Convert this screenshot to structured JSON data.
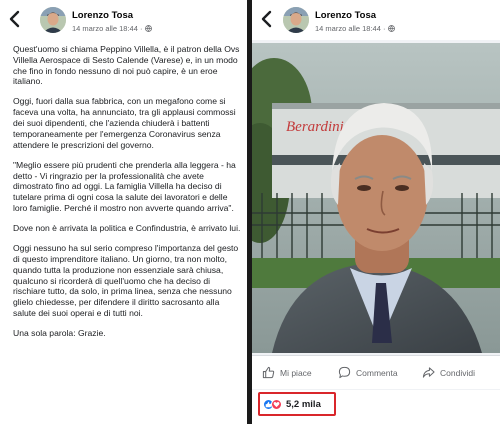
{
  "left_post": {
    "author": "Lorenzo Tosa",
    "timestamp": "14 marzo alle 18:44 · ",
    "paragraphs": [
      "Quest'uomo si chiama Peppino Villella, è il patron della Ovs Villella Aerospace di Sesto Calende (Varese) e, in un modo che fino in fondo nessuno di noi può capire, è un eroe italiano.",
      "Oggi, fuori dalla sua fabbrica, con un megafono come si faceva una volta, ha annunciato, tra gli applausi commossi dei suoi dipendenti, che l'azienda chiuderà i battenti temporaneamente per l'emergenza Coronavirus senza attendere le prescrizioni del governo.",
      "\"Meglio essere più prudenti che prenderla alla leggera - ha detto - Vi ringrazio per la professionalità che avete dimostrato fino ad oggi. La famiglia Villella ha deciso di tutelare prima di ogni cosa la salute dei lavoratori e delle loro famiglie. Perché il mostro non avverte quando arriva\".",
      "Dove non è arrivata la politica e Confindustria, è arrivato lui.",
      "Oggi nessuno ha sul serio compreso l'importanza del gesto di questo imprenditore italiano. Un giorno, tra non molto, quando tutta la produzione non essenziale sarà chiusa, qualcuno si ricorderà di quell'uomo che ha deciso di rischiare tutto, da solo, in prima linea, senza che nessuno glielo chiedesse, per difendere il diritto sacrosanto alla salute dei suoi operai e di tutti noi.",
      "Una sola parola: Grazie."
    ]
  },
  "right_post": {
    "author": "Lorenzo Tosa",
    "timestamp": "14 marzo alle 18:44 · ",
    "photo_sign_text": "Berardini",
    "actions": {
      "like": "Mi piace",
      "comment": "Commenta",
      "share": "Condividi"
    },
    "reactions_count": "5,2 mila"
  },
  "colors": {
    "facebook_blue": "#1877f2",
    "love_red": "#f33e58",
    "highlight_red": "#d9262b",
    "meta_gray": "#65676b"
  },
  "icons": [
    "back-arrow-icon",
    "globe-icon",
    "like-icon",
    "comment-icon",
    "share-icon",
    "like-reaction-icon",
    "love-reaction-icon"
  ]
}
